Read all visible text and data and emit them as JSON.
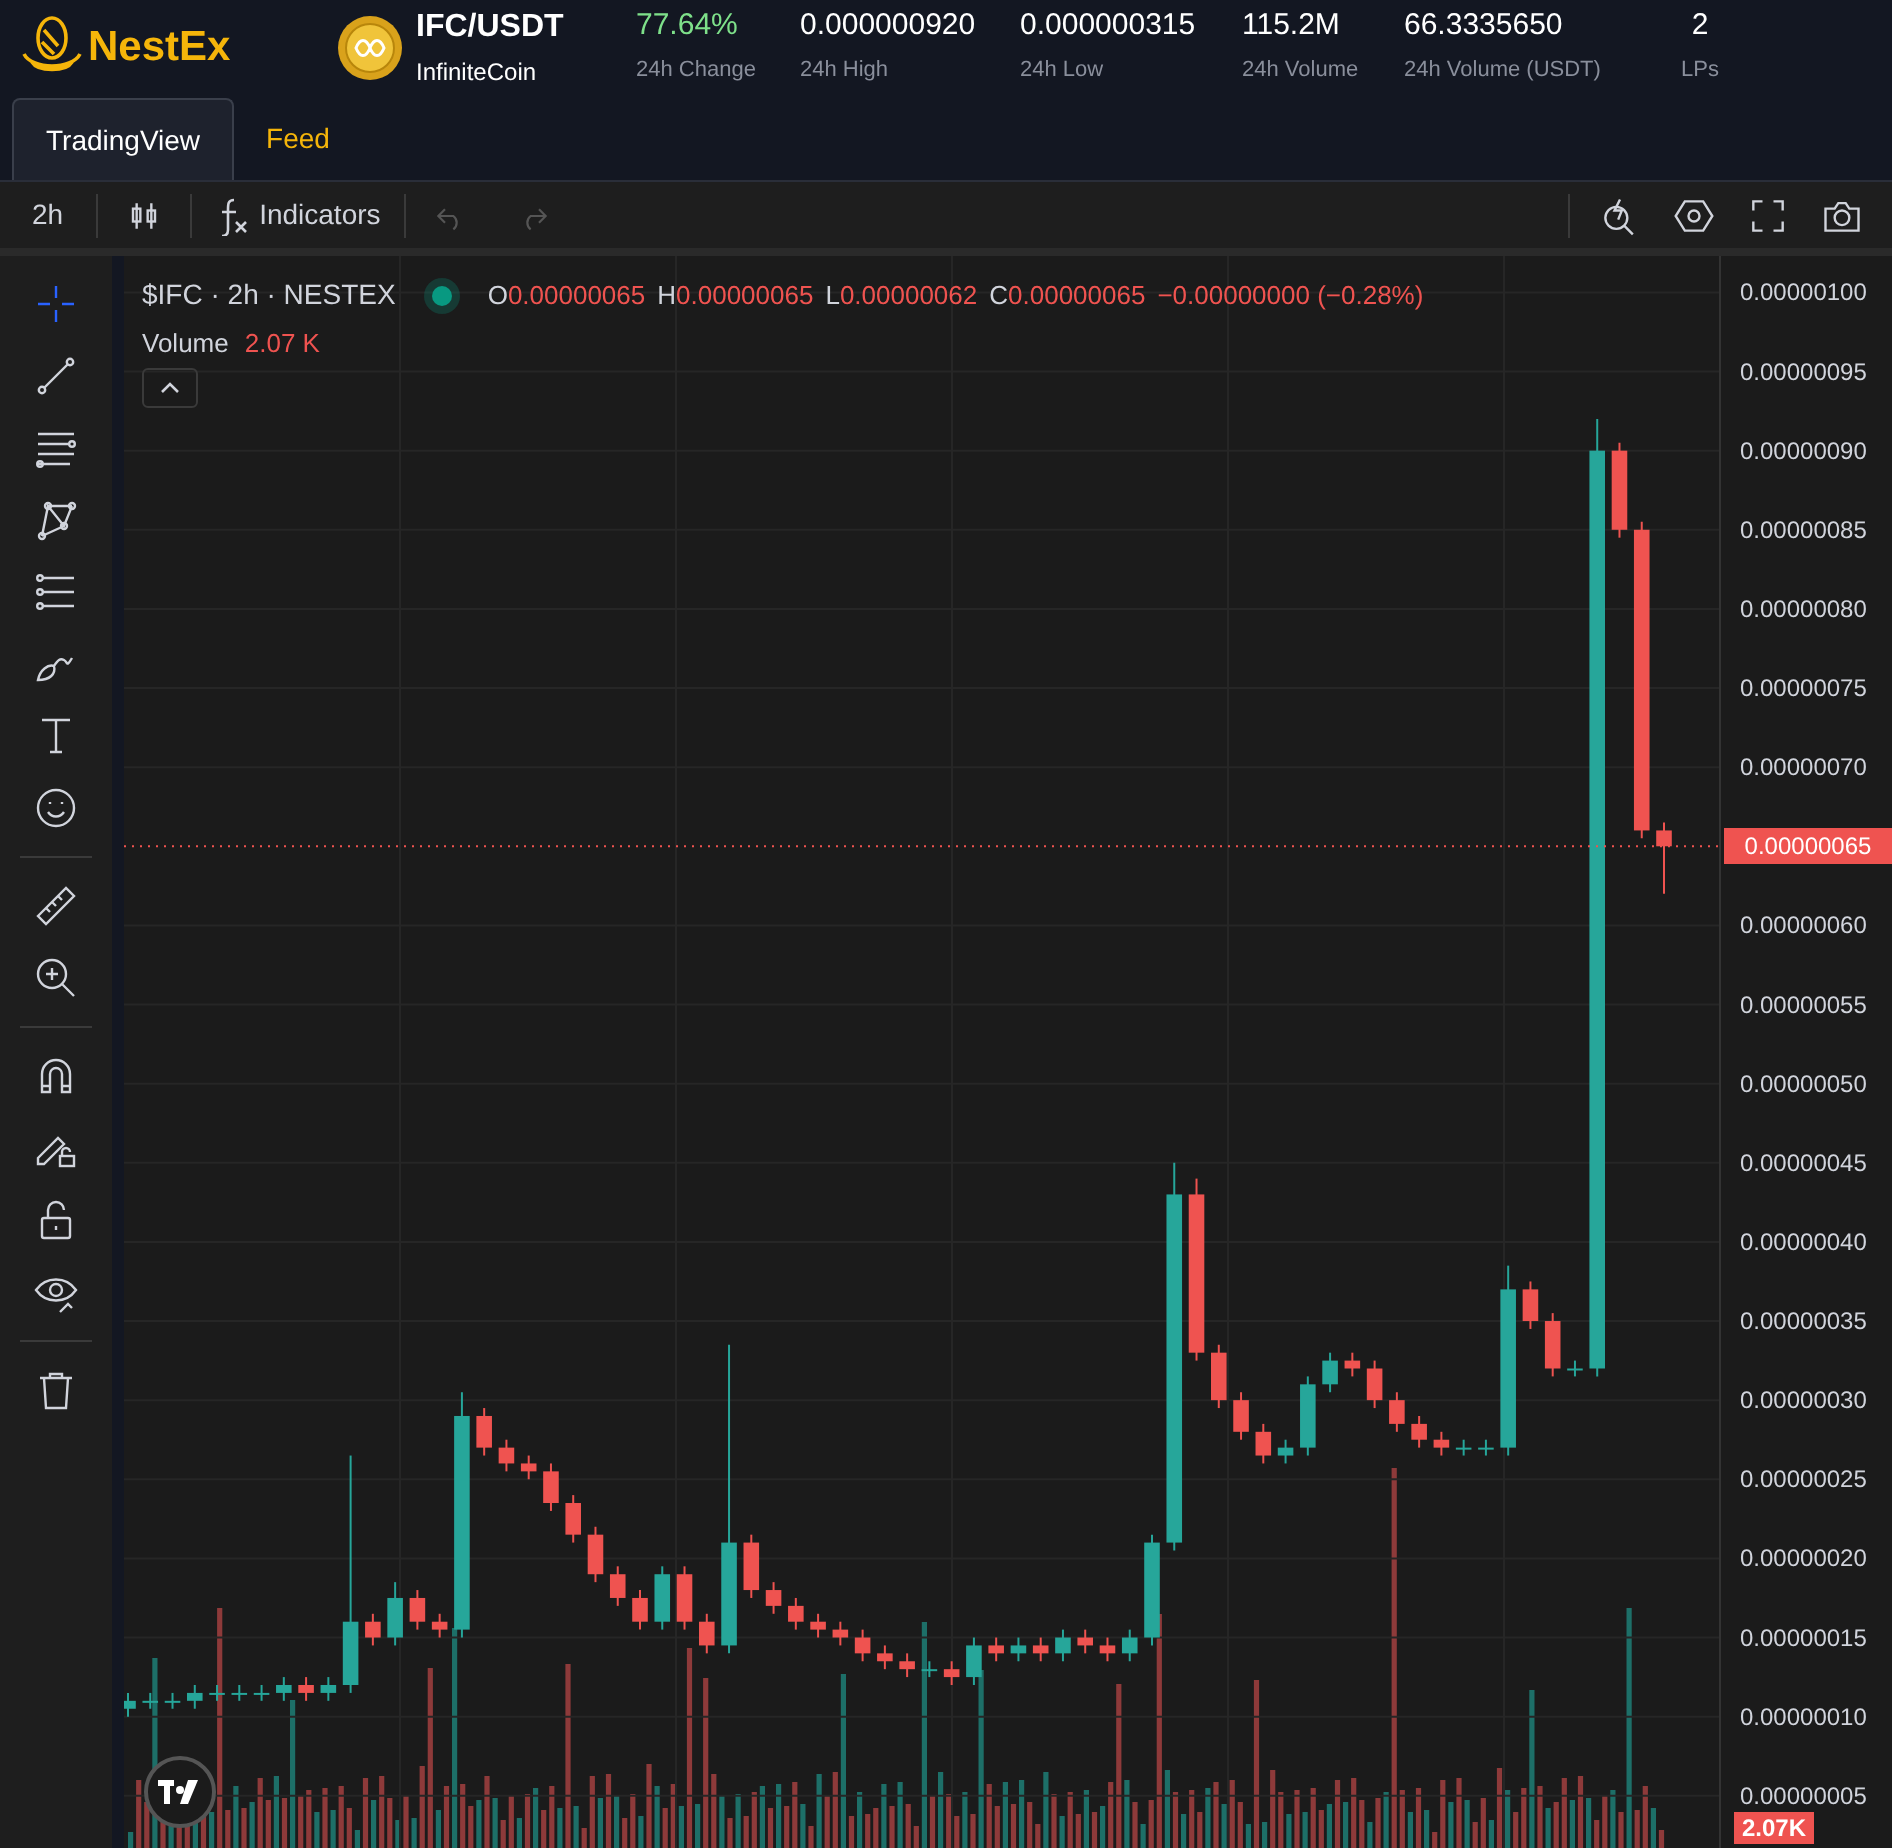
{
  "brand": {
    "name": "NestEx"
  },
  "pair": {
    "symbol": "IFC/USDT",
    "name": "InfiniteCoin"
  },
  "stats": [
    {
      "value": "77.64%",
      "label": "24h Change",
      "color": "#7ee08a"
    },
    {
      "value": "0.000000920",
      "label": "24h High",
      "color": "#ffffff"
    },
    {
      "value": "0.000000315",
      "label": "24h Low",
      "color": "#ffffff"
    },
    {
      "value": "115.2M",
      "label": "24h Volume",
      "color": "#ffffff"
    },
    {
      "value": "66.3335650",
      "label": "24h Volume (USDT)",
      "color": "#ffffff"
    },
    {
      "value": "2",
      "label": "LPs",
      "color": "#ffffff"
    }
  ],
  "tabs": [
    {
      "label": "TradingView",
      "selected": true
    },
    {
      "label": "Feed",
      "selected": false
    }
  ],
  "toolbar": {
    "interval": "2h",
    "indicators": "Indicators",
    "undo_disabled": true,
    "redo_disabled": true
  },
  "tool_groups": [
    [
      {
        "kind": "crosshair",
        "selected": true
      },
      {
        "kind": "trendline",
        "selected": false
      },
      {
        "kind": "fib",
        "selected": false
      },
      {
        "kind": "pattern",
        "selected": false
      },
      {
        "kind": "forecast",
        "selected": false
      },
      {
        "kind": "brush",
        "selected": false
      },
      {
        "kind": "text",
        "selected": false
      },
      {
        "kind": "emoji",
        "selected": false
      }
    ],
    [
      {
        "kind": "ruler",
        "selected": false
      },
      {
        "kind": "zoom",
        "selected": false
      }
    ],
    [
      {
        "kind": "magnet",
        "selected": false
      },
      {
        "kind": "lockdraw",
        "selected": false
      },
      {
        "kind": "lock",
        "selected": false
      },
      {
        "kind": "eye",
        "selected": false
      }
    ],
    [
      {
        "kind": "trash",
        "selected": false
      }
    ]
  ],
  "legend": {
    "ohlc": [
      {
        "label": "O",
        "value": "0.00000065"
      },
      {
        "label": "H",
        "value": "0.00000065"
      },
      {
        "label": "L",
        "value": "0.00000062"
      },
      {
        "label": "C",
        "value": "0.00000065"
      }
    ],
    "change": "−0.00000000 (−0.28%)",
    "volume_label": "Volume",
    "volume_value": "2.07 K"
  },
  "volume_badge": "2.07K",
  "chart": {
    "chart_data": {
      "type": "candlestick",
      "title": "$IFC · 2h · NESTEX",
      "grid": true,
      "ylim": [
        1.7e-08,
        1.023e-06
      ],
      "yticks": [
        {
          "value": 5e-08,
          "label": "0.00000005"
        },
        {
          "value": 1e-07,
          "label": "0.00000010"
        },
        {
          "value": 1.5e-07,
          "label": "0.00000015"
        },
        {
          "value": 2e-07,
          "label": "0.00000020"
        },
        {
          "value": 2.5e-07,
          "label": "0.00000025"
        },
        {
          "value": 3e-07,
          "label": "0.00000030"
        },
        {
          "value": 3.5e-07,
          "label": "0.00000035"
        },
        {
          "value": 4e-07,
          "label": "0.00000040"
        },
        {
          "value": 4.5e-07,
          "label": "0.00000045"
        },
        {
          "value": 5e-07,
          "label": "0.00000050"
        },
        {
          "value": 5.5e-07,
          "label": "0.00000055"
        },
        {
          "value": 6e-07,
          "label": "0.00000060"
        },
        {
          "value": 7e-07,
          "label": "0.00000070"
        },
        {
          "value": 7.5e-07,
          "label": "0.00000075"
        },
        {
          "value": 8e-07,
          "label": "0.00000080"
        },
        {
          "value": 8.5e-07,
          "label": "0.00000085"
        },
        {
          "value": 9e-07,
          "label": "0.00000090"
        },
        {
          "value": 9.5e-07,
          "label": "0.00000095"
        },
        {
          "value": 1e-06,
          "label": "0.00000100"
        }
      ],
      "ref_lines": [
        {
          "axis": "y",
          "value": 6.5e-07,
          "label": "0.00000065",
          "color": "#ef5350"
        }
      ],
      "ohlc": [
        [
          1.05e-07,
          1.15e-07,
          1e-07,
          1.1e-07
        ],
        [
          1.1e-07,
          1.15e-07,
          1.05e-07,
          1.1e-07
        ],
        [
          1.1e-07,
          1.15e-07,
          1.05e-07,
          1.1e-07
        ],
        [
          1.1e-07,
          1.2e-07,
          1.05e-07,
          1.15e-07
        ],
        [
          1.15e-07,
          1.2e-07,
          1.1e-07,
          1.15e-07
        ],
        [
          1.15e-07,
          1.2e-07,
          1.1e-07,
          1.15e-07
        ],
        [
          1.15e-07,
          1.2e-07,
          1.1e-07,
          1.15e-07
        ],
        [
          1.15e-07,
          1.25e-07,
          1.1e-07,
          1.2e-07
        ],
        [
          1.2e-07,
          1.25e-07,
          1.1e-07,
          1.15e-07
        ],
        [
          1.15e-07,
          1.25e-07,
          1.1e-07,
          1.2e-07
        ],
        [
          1.2e-07,
          2.65e-07,
          1.15e-07,
          1.6e-07
        ],
        [
          1.6e-07,
          1.65e-07,
          1.45e-07,
          1.5e-07
        ],
        [
          1.5e-07,
          1.85e-07,
          1.45e-07,
          1.75e-07
        ],
        [
          1.75e-07,
          1.8e-07,
          1.55e-07,
          1.6e-07
        ],
        [
          1.6e-07,
          1.65e-07,
          1.5e-07,
          1.55e-07
        ],
        [
          1.55e-07,
          3.05e-07,
          1.5e-07,
          2.9e-07
        ],
        [
          2.9e-07,
          2.95e-07,
          2.65e-07,
          2.7e-07
        ],
        [
          2.7e-07,
          2.75e-07,
          2.55e-07,
          2.6e-07
        ],
        [
          2.6e-07,
          2.65e-07,
          2.5e-07,
          2.55e-07
        ],
        [
          2.55e-07,
          2.6e-07,
          2.3e-07,
          2.35e-07
        ],
        [
          2.35e-07,
          2.4e-07,
          2.1e-07,
          2.15e-07
        ],
        [
          2.15e-07,
          2.2e-07,
          1.85e-07,
          1.9e-07
        ],
        [
          1.9e-07,
          1.95e-07,
          1.7e-07,
          1.75e-07
        ],
        [
          1.75e-07,
          1.8e-07,
          1.55e-07,
          1.6e-07
        ],
        [
          1.6e-07,
          1.95e-07,
          1.55e-07,
          1.9e-07
        ],
        [
          1.9e-07,
          1.95e-07,
          1.55e-07,
          1.6e-07
        ],
        [
          1.6e-07,
          1.65e-07,
          1.4e-07,
          1.45e-07
        ],
        [
          1.45e-07,
          3.35e-07,
          1.4e-07,
          2.1e-07
        ],
        [
          2.1e-07,
          2.15e-07,
          1.75e-07,
          1.8e-07
        ],
        [
          1.8e-07,
          1.85e-07,
          1.65e-07,
          1.7e-07
        ],
        [
          1.7e-07,
          1.75e-07,
          1.55e-07,
          1.6e-07
        ],
        [
          1.6e-07,
          1.65e-07,
          1.5e-07,
          1.55e-07
        ],
        [
          1.55e-07,
          1.6e-07,
          1.45e-07,
          1.5e-07
        ],
        [
          1.5e-07,
          1.55e-07,
          1.35e-07,
          1.4e-07
        ],
        [
          1.4e-07,
          1.45e-07,
          1.3e-07,
          1.35e-07
        ],
        [
          1.35e-07,
          1.4e-07,
          1.25e-07,
          1.3e-07
        ],
        [
          1.3e-07,
          1.35e-07,
          1.25e-07,
          1.3e-07
        ],
        [
          1.3e-07,
          1.35e-07,
          1.2e-07,
          1.25e-07
        ],
        [
          1.25e-07,
          1.5e-07,
          1.2e-07,
          1.45e-07
        ],
        [
          1.45e-07,
          1.5e-07,
          1.35e-07,
          1.4e-07
        ],
        [
          1.4e-07,
          1.5e-07,
          1.35e-07,
          1.45e-07
        ],
        [
          1.45e-07,
          1.5e-07,
          1.35e-07,
          1.4e-07
        ],
        [
          1.4e-07,
          1.55e-07,
          1.35e-07,
          1.5e-07
        ],
        [
          1.5e-07,
          1.55e-07,
          1.4e-07,
          1.45e-07
        ],
        [
          1.45e-07,
          1.5e-07,
          1.35e-07,
          1.4e-07
        ],
        [
          1.4e-07,
          1.55e-07,
          1.35e-07,
          1.5e-07
        ],
        [
          1.5e-07,
          2.15e-07,
          1.45e-07,
          2.1e-07
        ],
        [
          2.1e-07,
          4.5e-07,
          2.05e-07,
          4.3e-07
        ],
        [
          4.3e-07,
          4.4e-07,
          3.25e-07,
          3.3e-07
        ],
        [
          3.3e-07,
          3.35e-07,
          2.95e-07,
          3e-07
        ],
        [
          3e-07,
          3.05e-07,
          2.75e-07,
          2.8e-07
        ],
        [
          2.8e-07,
          2.85e-07,
          2.6e-07,
          2.65e-07
        ],
        [
          2.65e-07,
          2.75e-07,
          2.6e-07,
          2.7e-07
        ],
        [
          2.7e-07,
          3.15e-07,
          2.65e-07,
          3.1e-07
        ],
        [
          3.1e-07,
          3.3e-07,
          3.05e-07,
          3.25e-07
        ],
        [
          3.25e-07,
          3.3e-07,
          3.15e-07,
          3.2e-07
        ],
        [
          3.2e-07,
          3.25e-07,
          2.95e-07,
          3e-07
        ],
        [
          3e-07,
          3.05e-07,
          2.8e-07,
          2.85e-07
        ],
        [
          2.85e-07,
          2.9e-07,
          2.7e-07,
          2.75e-07
        ],
        [
          2.75e-07,
          2.8e-07,
          2.65e-07,
          2.7e-07
        ],
        [
          2.7e-07,
          2.75e-07,
          2.65e-07,
          2.7e-07
        ],
        [
          2.7e-07,
          2.75e-07,
          2.65e-07,
          2.7e-07
        ],
        [
          2.7e-07,
          3.85e-07,
          2.65e-07,
          3.7e-07
        ],
        [
          3.7e-07,
          3.75e-07,
          3.45e-07,
          3.5e-07
        ],
        [
          3.5e-07,
          3.55e-07,
          3.15e-07,
          3.2e-07
        ],
        [
          3.2e-07,
          3.25e-07,
          3.15e-07,
          3.2e-07
        ],
        [
          3.2e-07,
          9.2e-07,
          3.15e-07,
          9e-07
        ],
        [
          9e-07,
          9.05e-07,
          8.45e-07,
          8.5e-07
        ],
        [
          8.5e-07,
          8.55e-07,
          6.55e-07,
          6.6e-07
        ],
        [
          6.6e-07,
          6.65e-07,
          6.2e-07,
          6.5e-07
        ]
      ]
    }
  }
}
